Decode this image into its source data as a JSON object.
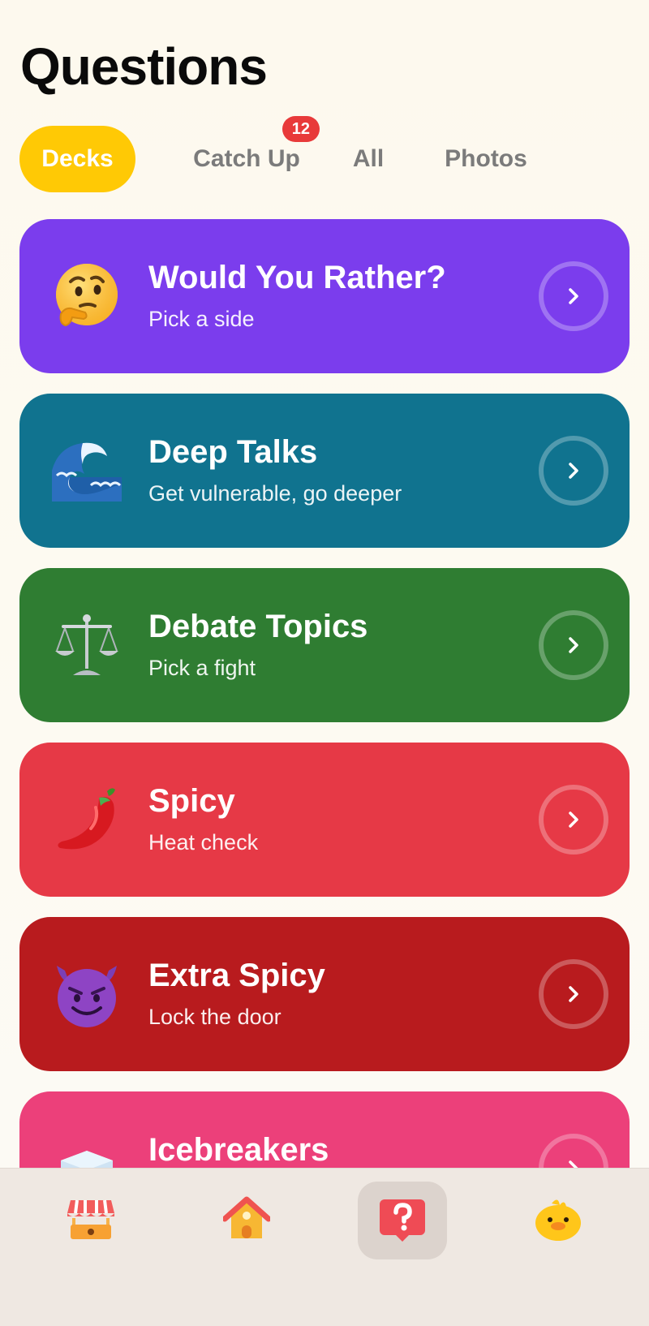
{
  "page": {
    "title": "Questions"
  },
  "tabs": [
    {
      "label": "Decks",
      "active": true
    },
    {
      "label": "Catch Up",
      "badge": "12"
    },
    {
      "label": "All"
    },
    {
      "label": "Photos"
    }
  ],
  "decks": [
    {
      "title": "Would You Rather?",
      "subtitle": "Pick a side",
      "color": "#7b3ded",
      "icon": "thinking-face-icon"
    },
    {
      "title": "Deep Talks",
      "subtitle": "Get vulnerable, go deeper",
      "color": "#10738f",
      "icon": "wave-icon"
    },
    {
      "title": "Debate Topics",
      "subtitle": "Pick a fight",
      "color": "#2f7d32",
      "icon": "scales-icon"
    },
    {
      "title": "Spicy",
      "subtitle": "Heat check",
      "color": "#e63946",
      "icon": "chili-pepper-icon"
    },
    {
      "title": "Extra Spicy",
      "subtitle": "Lock the door",
      "color": "#b81b1e",
      "icon": "smiling-devil-icon"
    },
    {
      "title": "Icebreakers",
      "subtitle": "",
      "color": "#ec407a",
      "icon": "ice-cube-icon"
    }
  ],
  "nav": [
    {
      "name": "shop",
      "icon": "market-stall-icon"
    },
    {
      "name": "home",
      "icon": "house-icon"
    },
    {
      "name": "questions",
      "icon": "question-bubble-icon",
      "active": true
    },
    {
      "name": "profile",
      "icon": "duck-icon"
    }
  ]
}
